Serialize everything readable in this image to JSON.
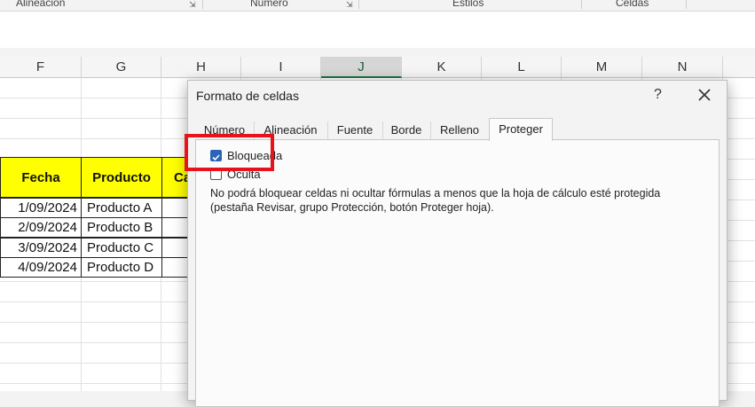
{
  "ribbon": {
    "groups": [
      "Alineación",
      "Número",
      "Estilos",
      "Celdas"
    ]
  },
  "columns": [
    "F",
    "G",
    "H",
    "I",
    "J",
    "K",
    "L",
    "M",
    "N"
  ],
  "table": {
    "headers": [
      "Fecha",
      "Producto",
      "Ca"
    ],
    "rows": [
      [
        "1/09/2024",
        "Producto A"
      ],
      [
        "2/09/2024",
        "Producto B"
      ],
      [
        "3/09/2024",
        "Producto C"
      ],
      [
        "4/09/2024",
        "Producto D"
      ]
    ]
  },
  "dialog": {
    "title": "Formato de celdas",
    "help": "?",
    "tabs": [
      "Número",
      "Alineación",
      "Fuente",
      "Borde",
      "Relleno",
      "Proteger"
    ],
    "active_tab": "Proteger",
    "options": [
      {
        "label": "Bloqueada",
        "checked": true
      },
      {
        "label": "Oculta",
        "checked": false
      }
    ],
    "info_line1": "No podrá bloquear celdas ni ocultar fórmulas a menos que la hoja de cálculo esté protegida",
    "info_line2": "(pestaña Revisar, grupo Protección, botón Proteger hoja)."
  },
  "colors": {
    "header_fill": "#ffff00",
    "highlight": "#e8121a",
    "checkbox_checked": "#2a63b8",
    "selected_column": "#1e7145"
  }
}
